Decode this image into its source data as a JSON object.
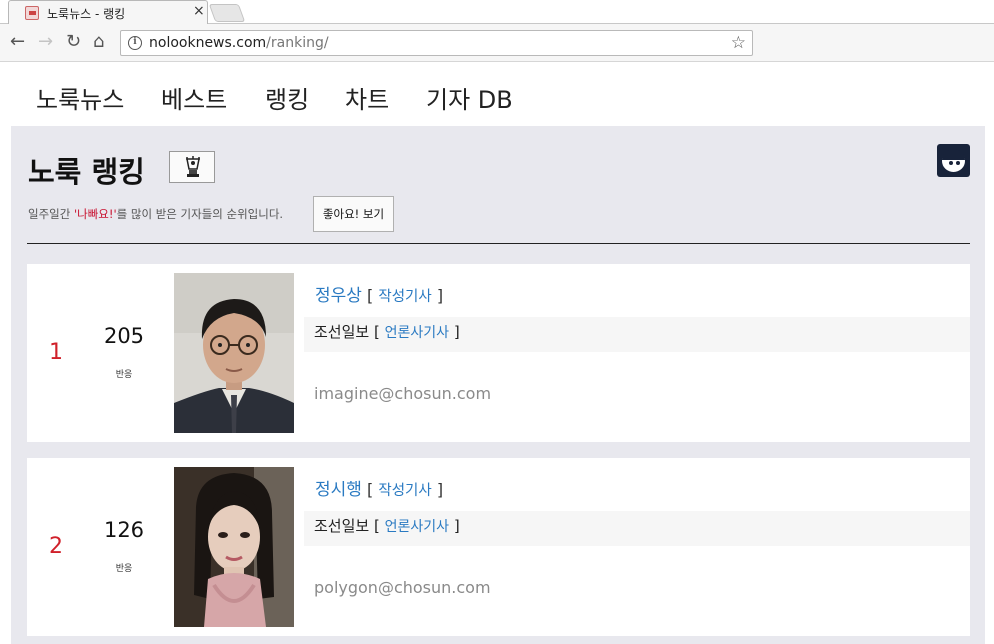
{
  "browser": {
    "tab_title": "노룩뉴스 - 랭킹",
    "tab_close": "×",
    "url_domain": "nolooknews.com",
    "url_path": "/ranking/",
    "back": "←",
    "forward": "→",
    "reload": "↻",
    "home": "⌂",
    "star": "☆",
    "info": "i"
  },
  "nav": {
    "items": [
      "노룩뉴스",
      "베스트",
      "랭킹",
      "차트",
      "기자 DB"
    ]
  },
  "page": {
    "title": "노룩 랭킹",
    "subtitle_pre": "일주일간 ",
    "subtitle_highlight": "'나빠요!'",
    "subtitle_post": "를 많이 받은 기자들의 순위입니다.",
    "like_button": "좋아요! 보기"
  },
  "ranking": [
    {
      "rank": "1",
      "count": "205",
      "count_label": "반응",
      "name": "정우상",
      "articles_link": "작성기사",
      "press": "조선일보",
      "press_link": "언론사기사",
      "email": "imagine@chosun.com"
    },
    {
      "rank": "2",
      "count": "126",
      "count_label": "반응",
      "name": "정시행",
      "articles_link": "작성기사",
      "press": "조선일보",
      "press_link": "언론사기사",
      "email": "polygon@chosun.com"
    }
  ],
  "colors": {
    "accent_link": "#2a7ac2",
    "rank_red": "#d0202a",
    "panel_bg": "#e8e8ee"
  }
}
